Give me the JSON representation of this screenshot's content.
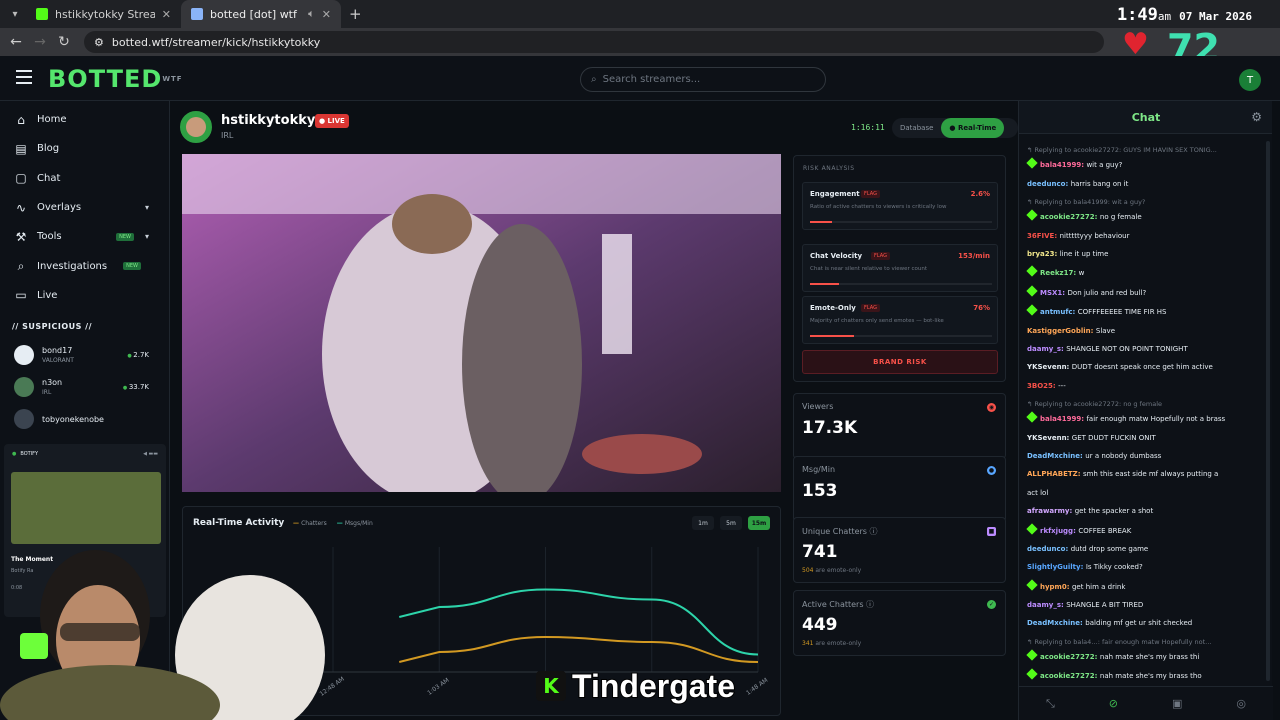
{
  "browser": {
    "tabs": [
      {
        "title": "hstikkytokky Stream - Watch Li",
        "favicon_color": "#53fc18"
      },
      {
        "title": "botted [dot] wtf",
        "favicon_color": "#8ab4f8"
      }
    ],
    "url": "botted.wtf/streamer/kick/hstikkytokky",
    "clock_time": "1:49",
    "clock_ampm": "am",
    "clock_date": "07 Mar 2026",
    "heart_rate": "72"
  },
  "header": {
    "logo": "BOTTED",
    "logo_sup": "WTF",
    "search_placeholder": "Search streamers...",
    "avatar_letter": "T"
  },
  "sidebar": {
    "nav": [
      {
        "label": "Home",
        "icon": "home-icon",
        "glyph": "⌂"
      },
      {
        "label": "Blog",
        "icon": "document-icon",
        "glyph": "▤"
      },
      {
        "label": "Chat",
        "icon": "chat-icon",
        "glyph": "▢"
      },
      {
        "label": "Overlays",
        "icon": "pulse-icon",
        "glyph": "∿",
        "chevron": true
      },
      {
        "label": "Tools",
        "icon": "wrench-icon",
        "glyph": "⚒",
        "badge": "NEW",
        "chevron": true
      },
      {
        "label": "Investigations",
        "icon": "search-icon",
        "glyph": "⌕",
        "badge": "NEW"
      },
      {
        "label": "Live",
        "icon": "tv-icon",
        "glyph": "▭"
      }
    ],
    "suspicious_title": "// SUSPICIOUS //",
    "suspicious": [
      {
        "name": "bond17",
        "category": "VALORANT",
        "count": "2.7K"
      },
      {
        "name": "n3on",
        "category": "IRL",
        "count": "33.7K"
      },
      {
        "name": "tobyonekenobe",
        "category": "",
        "count": ""
      }
    ],
    "botify": {
      "label": "BOTIFY",
      "song": "The Moment",
      "artist": "Botify Ra",
      "time": "0:08"
    }
  },
  "stream": {
    "streamer": "hstikkytokky",
    "live_label": "● LIVE",
    "category": "IRL",
    "uptime": "1:16:11",
    "modes": [
      "Database",
      "● Real-Time"
    ]
  },
  "activity": {
    "title": "Real-Time Activity",
    "legend": [
      "Chatters",
      "Msgs/Min"
    ],
    "ranges": [
      "1m",
      "5m",
      "15m"
    ],
    "active_range": "15m"
  },
  "chart_data": {
    "type": "line",
    "x": [
      "12:48 AM",
      "1:03 AM",
      "1:18 AM",
      "1:33 AM",
      "1:48 AM"
    ],
    "series": [
      {
        "name": "Msgs/Min",
        "color": "#2dd4aa",
        "values": [
          null,
          0.52,
          0.66,
          0.58,
          0.14
        ]
      },
      {
        "name": "Chatters",
        "color": "#d29922",
        "values": [
          null,
          0.16,
          0.28,
          0.24,
          0.08
        ]
      }
    ],
    "xlabel": "",
    "ylabel": "",
    "xtick_labels": [
      "12:48 AM",
      "1:03 AM",
      "",
      "",
      "1:48 AM"
    ]
  },
  "risk": {
    "title": "RISK ANALYSIS",
    "metrics": [
      {
        "name": "Engagement",
        "flag": "FLAG",
        "value": "2.6%",
        "desc": "Ratio of active chatters to viewers is critically low",
        "fill": 0.12
      },
      {
        "name": "Chat Velocity",
        "flag": "FLAG",
        "value": "153/min",
        "desc": "Chat is near silent relative to viewer count",
        "fill": 0.16
      },
      {
        "name": "Emote-Only",
        "flag": "FLAG",
        "value": "76%",
        "desc": "Majority of chatters only send emotes — bot-like",
        "fill": 0.24
      }
    ],
    "brand_risk": "BRAND RISK"
  },
  "stats": [
    {
      "label": "Viewers",
      "value": "17.3K",
      "sub_num": "",
      "sub_text": "",
      "icon": "eye-icon",
      "icon_color": "#f85149",
      "glyph": "◉"
    },
    {
      "label": "Msg/Min",
      "value": "153",
      "sub_num": "",
      "sub_text": "",
      "icon": "message-icon",
      "icon_color": "#58a6ff",
      "glyph": "●"
    },
    {
      "label": "Unique Chatters",
      "value": "741",
      "sub_num": "504",
      "sub_text": " are emote-only",
      "icon": "users-icon",
      "icon_color": "#bc8cff",
      "glyph": "■"
    },
    {
      "label": "Active Chatters",
      "value": "449",
      "sub_num": "341",
      "sub_text": " are emote-only",
      "icon": "check-icon",
      "icon_color": "#3fb950",
      "glyph": "✓"
    }
  ],
  "chat": {
    "title": "Chat",
    "messages": [
      {
        "reply": "↰ Replying to acookie27272: GUYS IM HAVIN SEX TONIG..."
      },
      {
        "user": "bala41999",
        "color": "#ff6b9a",
        "badge": true,
        "text": "wit a guy?"
      },
      {
        "user": "deedunco",
        "color": "#79c0ff",
        "text": "harris bang on it"
      },
      {
        "reply": "↰ Replying to bala41999: wit a guy?"
      },
      {
        "user": "acookie27272",
        "color": "#7ee787",
        "badge": true,
        "text": "no g female"
      },
      {
        "user": "36FIVE",
        "color": "#f85149",
        "text": "nitttttyyy behaviour"
      },
      {
        "user": "brya23",
        "color": "#f0e68c",
        "text": "line it up time"
      },
      {
        "user": "Reekz17",
        "color": "#7ee787",
        "badge": true,
        "text": "w"
      },
      {
        "user": "MSX1",
        "color": "#bc8cff",
        "badge": true,
        "text": "Don julio and red bull?"
      },
      {
        "user": "antmufc",
        "color": "#79c0ff",
        "badge": true,
        "text": "COFFFEEEEE TIME FIR HS"
      },
      {
        "user": "KastiggerGoblin",
        "color": "#ffa657",
        "text": "Slave"
      },
      {
        "user": "daamy_s",
        "color": "#bc8cff",
        "text": "SHANGLE NOT ON POINT TONIGHT"
      },
      {
        "user": "YKSevenn",
        "color": "#e6edf3",
        "text": "DUDT doesnt speak once get him active"
      },
      {
        "user": "3BO25",
        "color": "#f85149",
        "text": "---"
      },
      {
        "reply": "↰ Replying to acookie27272: no g female"
      },
      {
        "user": "bala41999",
        "color": "#ff6b9a",
        "badge": true,
        "text": "fair enough matw Hopefully not a brass"
      },
      {
        "user": "YKSevenn",
        "color": "#e6edf3",
        "text": "GET DUDT FUCKIN ONIT"
      },
      {
        "user": "DeadMxchine",
        "color": "#79c0ff",
        "text": "ur a nobody dumbass"
      },
      {
        "user": "ALLPHABETZ",
        "color": "#ffa657",
        "text": "smh this east side mf always putting a"
      },
      {
        "user": "",
        "color": "#e6edf3",
        "text": "act lol"
      },
      {
        "user": "afrawarmy",
        "color": "#d2a8ff",
        "text": "get the spacker a  shot"
      },
      {
        "user": "rkfxjugg",
        "color": "#bc8cff",
        "badge": true,
        "text": "COFFEE BREAK"
      },
      {
        "user": "deedunco",
        "color": "#79c0ff",
        "text": "dutd drop some game"
      },
      {
        "user": "SlightlyGuilty",
        "color": "#58a6ff",
        "text": "Is Tikky cooked?"
      },
      {
        "user": "hypm0",
        "color": "#ffa657",
        "badge": true,
        "text": "get him a drink"
      },
      {
        "user": "daamy_s",
        "color": "#bc8cff",
        "text": "SHANGLE A BIT TIRED"
      },
      {
        "user": "DeadMxchine",
        "color": "#79c0ff",
        "text": "balding mf get ur shit checked"
      },
      {
        "reply": "↰ Replying to bala4…: fair enough matw Hopefully not…"
      },
      {
        "user": "acookie27272",
        "color": "#7ee787",
        "badge": true,
        "text": "nah mate she's my brass thi"
      },
      {
        "user": "acookie27272",
        "color": "#7ee787",
        "badge": true,
        "text": "nah mate she's my brass tho"
      }
    ]
  },
  "overlay": {
    "k": "K",
    "text": "Tindergate"
  }
}
